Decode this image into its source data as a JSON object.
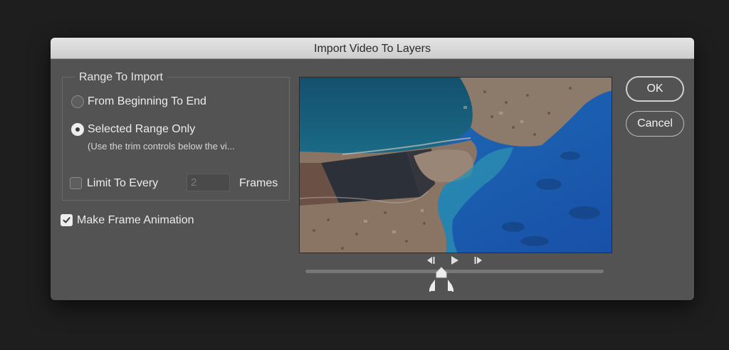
{
  "dialog": {
    "title": "Import Video To Layers"
  },
  "range_group": {
    "legend": "Range To Import",
    "options": [
      {
        "label": "From Beginning To End",
        "selected": false
      },
      {
        "label": "Selected Range Only",
        "selected": true
      }
    ],
    "hint": "(Use the trim controls below the vi...",
    "limit": {
      "label": "Limit To Every",
      "checked": false,
      "value": "2",
      "unit_label": "Frames"
    }
  },
  "make_frame_animation": {
    "label": "Make Frame Animation",
    "checked": true
  },
  "buttons": {
    "ok": "OK",
    "cancel": "Cancel"
  },
  "transport": {
    "icons": [
      "step-back-icon",
      "play-icon",
      "step-forward-icon"
    ],
    "playhead_position": 0.46,
    "trim_start": 0.46,
    "trim_end": 0.46
  },
  "colors": {
    "dialog_bg": "#535353",
    "titlebar": "#d8d8d8",
    "text": "#ececec"
  }
}
